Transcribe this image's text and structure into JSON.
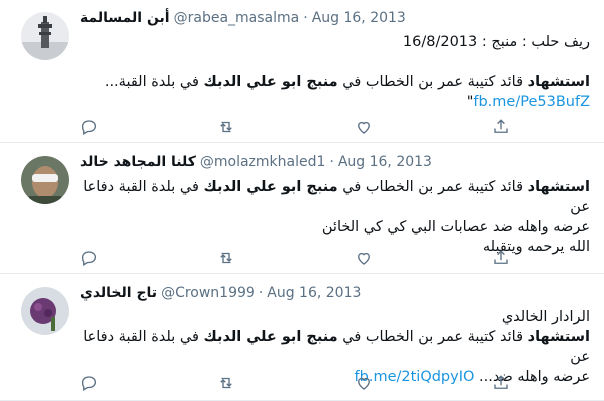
{
  "tweets": [
    {
      "name": "أبن المسالمة",
      "handle": "@rabea_masalma",
      "sep": "·",
      "date": "Aug 16, 2013",
      "line1": "ريف حلب : منبج : 16/8/2013",
      "line2_bold_a": "استشهاد",
      "line2_plain": " قائد كتيبة عمر بن الخطاب في ",
      "line2_bold_b": "منبج ابو علي الدبك",
      "line2_end": " في بلدة القبة...",
      "link": "fb.me/Pe53BufZ",
      "quote_mark": "\""
    },
    {
      "name": "كلنا المجاهد خالد",
      "handle": "@molazmkhaled1",
      "sep": "·",
      "date": "Aug 16, 2013",
      "line1_bold_a": "استشهاد",
      "line1_plain": " قائد كتيبة عمر بن الخطاب في ",
      "line1_bold_b": "منبج ابو علي الدبك",
      "line1_end": " في بلدة القبة دفاعا عن",
      "line2": "عرضه واهله ضد عصابات البي كي كي الخائن",
      "line3": "الله يرحمه ويتقبله"
    },
    {
      "name": "تاج الخالدي",
      "handle": "@Crown1999",
      "sep": "·",
      "date": "Aug 16, 2013",
      "line1": "الرادار الخالدي",
      "line2_bold_a": "استشهاد",
      "line2_plain": " قائد كتيبة عمر بن الخطاب في ",
      "line2_bold_b": "منبج ابو علي الدبك",
      "line2_end": " في بلدة القبة دفاعا عن",
      "line3": "عرضه واهله ضد...",
      "link": "fb.me/2tiQdpyIO"
    }
  ],
  "icons": [
    "reply-icon",
    "retweet-icon",
    "like-icon",
    "share-icon"
  ],
  "colors": {
    "muted": "#5b7083",
    "link": "#1b95e0",
    "border": "#e6ecf0"
  }
}
